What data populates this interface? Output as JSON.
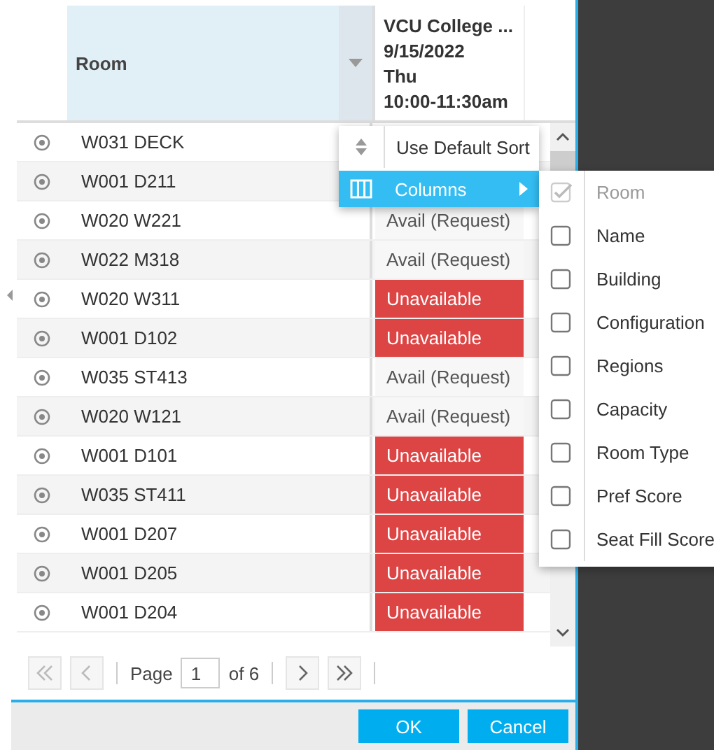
{
  "grid": {
    "header": {
      "room": {
        "label": "Room",
        "selected": true
      },
      "event": [
        "VCU College ...",
        "9/15/2022",
        "Thu",
        "10:00-11:30am"
      ]
    },
    "rows": [
      {
        "room": "W031 DECK"
      },
      {
        "room": "W001 D211"
      },
      {
        "room": "W020 W221",
        "status": {
          "kind": "avail",
          "text": "Avail (Request)"
        }
      },
      {
        "room": "W022 M318",
        "status": {
          "kind": "avail",
          "text": "Avail (Request)"
        }
      },
      {
        "room": "W020 W311",
        "status": {
          "kind": "unavailable",
          "text": "Unavailable"
        }
      },
      {
        "room": "W001 D102",
        "status": {
          "kind": "unavailable",
          "text": "Unavailable"
        }
      },
      {
        "room": "W035 ST413",
        "status": {
          "kind": "avail",
          "text": "Avail (Request)"
        }
      },
      {
        "room": "W020 W121",
        "status": {
          "kind": "avail",
          "text": "Avail (Request)"
        }
      },
      {
        "room": "W001 D101",
        "status": {
          "kind": "unavailable",
          "text": "Unavailable"
        }
      },
      {
        "room": "W035 ST411",
        "status": {
          "kind": "unavailable",
          "text": "Unavailable"
        }
      },
      {
        "room": "W001 D207",
        "status": {
          "kind": "unavailable",
          "text": "Unavailable"
        }
      },
      {
        "room": "W001 D205",
        "status": {
          "kind": "unavailable",
          "text": "Unavailable"
        }
      },
      {
        "room": "W001 D204",
        "status": {
          "kind": "unavailable",
          "text": "Unavailable"
        }
      }
    ]
  },
  "menu": [
    {
      "kind": "sort",
      "label": "Use Default Sort",
      "selected": false
    },
    {
      "kind": "columns",
      "label": "Columns",
      "selected": true
    }
  ],
  "columns_menu": [
    {
      "label": "Room",
      "checked": true,
      "disabled": true
    },
    {
      "label": "Name",
      "checked": false,
      "disabled": false
    },
    {
      "label": "Building",
      "checked": false,
      "disabled": false
    },
    {
      "label": "Configuration",
      "checked": false,
      "disabled": false
    },
    {
      "label": "Regions",
      "checked": false,
      "disabled": false
    },
    {
      "label": "Capacity",
      "checked": false,
      "disabled": false
    },
    {
      "label": "Room Type",
      "checked": false,
      "disabled": false
    },
    {
      "label": "Pref Score",
      "checked": false,
      "disabled": false
    },
    {
      "label": "Seat Fill Score",
      "checked": false,
      "disabled": false
    }
  ],
  "pager": {
    "label": "Page",
    "value": "1",
    "total": "of 6"
  },
  "buttons": [
    "OK",
    "Cancel"
  ]
}
